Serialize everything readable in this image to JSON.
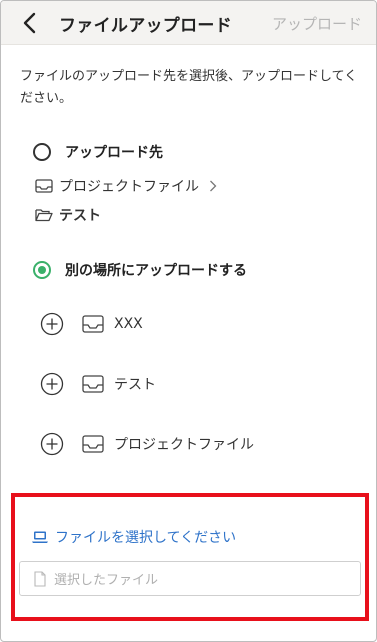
{
  "header": {
    "title": "ファイルアップロード",
    "upload_label": "アップロード"
  },
  "description": "ファイルのアップロード先を選択後、アップロードしてください。",
  "destination": {
    "label": "アップロード先",
    "path_root": "プロジェクトファイル",
    "path_folder": "テスト"
  },
  "other_location": {
    "label": "別の場所にアップロードする",
    "items": [
      "XXX",
      "テスト",
      "プロジェクトファイル"
    ]
  },
  "file_select": {
    "link_label": "ファイルを選択してください",
    "placeholder": "選択したファイル"
  },
  "colors": {
    "accent_green": "#3ab06a",
    "link_blue": "#2f73c9",
    "highlight_red": "#e8101b",
    "header_bg": "#f4f3f1"
  }
}
